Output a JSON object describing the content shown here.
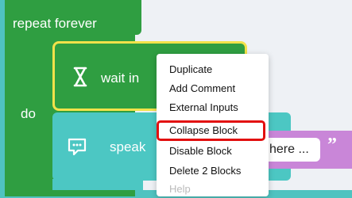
{
  "blocks": {
    "repeat_label": "repeat forever",
    "do_label": "do",
    "wait_label": "wait in",
    "speak_label": "speak",
    "text_value": "here ...",
    "quote_mark": "”"
  },
  "context_menu": {
    "items": [
      {
        "label": "Duplicate",
        "enabled": true
      },
      {
        "label": "Add Comment",
        "enabled": true
      },
      {
        "label": "External Inputs",
        "enabled": true
      },
      {
        "label": "Collapse Block",
        "enabled": true,
        "highlighted": true
      },
      {
        "label": "Disable Block",
        "enabled": true
      },
      {
        "label": "Delete 2 Blocks",
        "enabled": true
      },
      {
        "label": "Help",
        "enabled": false
      }
    ]
  },
  "icons": {
    "wait_icon": "hourglass-icon",
    "speak_icon": "speech-bubble-icon"
  },
  "colors": {
    "frame": "#4fc3c0",
    "workspace": "#eef1f5",
    "loop_block": "#2f9e41",
    "selection_outline": "#f2e24a",
    "speak_block": "#4cc7c3",
    "text_block": "#c986d8",
    "highlight": "#e20f0f"
  }
}
